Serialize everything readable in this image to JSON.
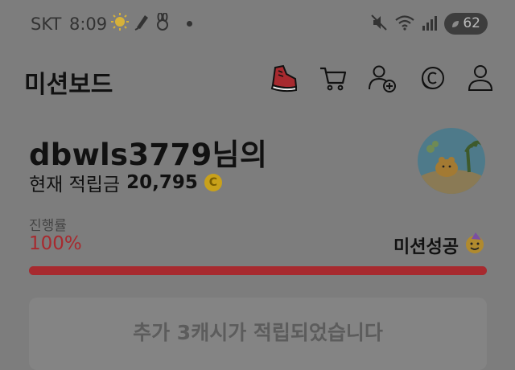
{
  "status_bar": {
    "carrier": "SKT",
    "time": "8:09",
    "battery": "62",
    "icons_left": [
      "sun-icon",
      "pen-icon",
      "rabbit-icon",
      "dot-icon"
    ],
    "icons_right": [
      "mute-icon",
      "wifi-icon",
      "signal-icon",
      "battery-icon"
    ]
  },
  "header": {
    "title": "미션보드",
    "icons": [
      "sneaker-icon",
      "cart-icon",
      "add-user-icon",
      "coin-icon",
      "profile-icon"
    ]
  },
  "user": {
    "name": "dbwls3779님의",
    "cash_label": "현재 적립금",
    "cash_amount": "20,795",
    "coin_symbol": "C"
  },
  "progress": {
    "label": "진행률",
    "value_text": "100%",
    "fraction": 1.0,
    "status": "미션성공",
    "status_emoji": "🥳"
  },
  "notice": {
    "text": "추가 3캐시가 적립되었습니다"
  },
  "colors": {
    "accent_red": "#a72a2f",
    "coin_gold": "#c9a11a"
  }
}
